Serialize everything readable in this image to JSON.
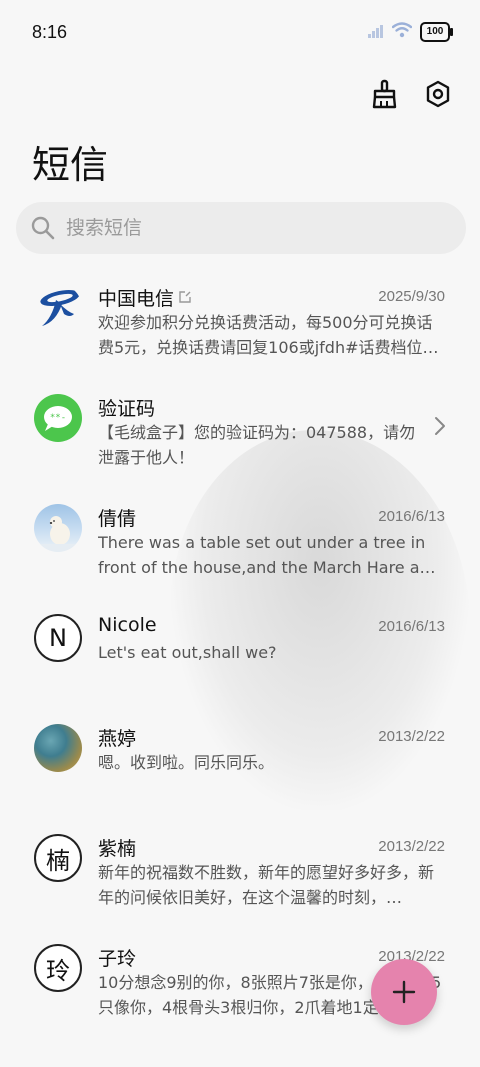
{
  "status_bar": {
    "time": "8:16",
    "battery": "100"
  },
  "header": {
    "title": "短信"
  },
  "search": {
    "placeholder": "搜索短信"
  },
  "messages": [
    {
      "name": "中国电信",
      "date": "2025/9/30",
      "preview": "欢迎参加积分兑换话费活动，每500分可兑换话费5元，兑换话费请回复106或jfdh#话费档位…",
      "avatar": "telecom-logo-icon"
    },
    {
      "name": "验证码",
      "date": "",
      "preview": "【毛绒盒子】您的验证码为：047588，请勿泄露于他人！",
      "avatar": "chat-bubble-icon"
    },
    {
      "name": "倩倩",
      "date": "2016/6/13",
      "preview": "There was a table set out under a tree in front of the house,and the March Hare and the Hatter…",
      "avatar": "polar-bear-photo"
    },
    {
      "name": "Nicole",
      "date": "2016/6/13",
      "preview": "Let's eat out,shall we?",
      "avatar_letter": "N"
    },
    {
      "name": "燕婷",
      "date": "2013/2/22",
      "preview": "嗯。收到啦。同乐同乐。",
      "avatar": "landscape-photo"
    },
    {
      "name": "紫楠",
      "date": "2013/2/22",
      "preview": "新年的祝福数不胜数，新年的愿望好多好多，新年的问候依旧美好，在这个温馨的时刻，…",
      "avatar_letter": "楠"
    },
    {
      "name": "子玲",
      "date": "2013/2/22",
      "preview": "10分想念9别的你，8张照片7张是你，6只小狗5只像你，4根骨头3根归你，2爪着地1定…",
      "avatar_letter": "玲"
    }
  ],
  "colors": {
    "fab": "#e583ad",
    "telecom_blue": "#1c4fa0",
    "chat_green": "#4cc64c"
  }
}
